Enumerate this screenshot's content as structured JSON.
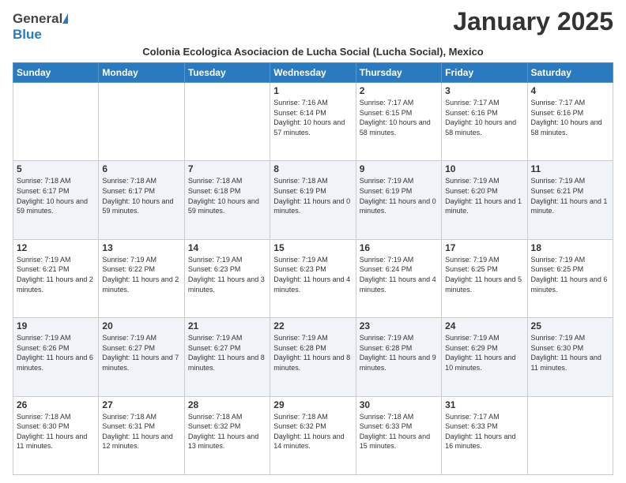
{
  "header": {
    "logo_general": "General",
    "logo_blue": "Blue",
    "main_title": "January 2025",
    "subtitle": "Colonia Ecologica Asociacion de Lucha Social (Lucha Social), Mexico"
  },
  "weekdays": [
    "Sunday",
    "Monday",
    "Tuesday",
    "Wednesday",
    "Thursday",
    "Friday",
    "Saturday"
  ],
  "weeks": [
    {
      "shaded": false,
      "days": [
        {
          "num": "",
          "info": ""
        },
        {
          "num": "",
          "info": ""
        },
        {
          "num": "",
          "info": ""
        },
        {
          "num": "1",
          "info": "Sunrise: 7:16 AM\nSunset: 6:14 PM\nDaylight: 10 hours\nand 57 minutes."
        },
        {
          "num": "2",
          "info": "Sunrise: 7:17 AM\nSunset: 6:15 PM\nDaylight: 10 hours\nand 58 minutes."
        },
        {
          "num": "3",
          "info": "Sunrise: 7:17 AM\nSunset: 6:16 PM\nDaylight: 10 hours\nand 58 minutes."
        },
        {
          "num": "4",
          "info": "Sunrise: 7:17 AM\nSunset: 6:16 PM\nDaylight: 10 hours\nand 58 minutes."
        }
      ]
    },
    {
      "shaded": true,
      "days": [
        {
          "num": "5",
          "info": "Sunrise: 7:18 AM\nSunset: 6:17 PM\nDaylight: 10 hours\nand 59 minutes."
        },
        {
          "num": "6",
          "info": "Sunrise: 7:18 AM\nSunset: 6:17 PM\nDaylight: 10 hours\nand 59 minutes."
        },
        {
          "num": "7",
          "info": "Sunrise: 7:18 AM\nSunset: 6:18 PM\nDaylight: 10 hours\nand 59 minutes."
        },
        {
          "num": "8",
          "info": "Sunrise: 7:18 AM\nSunset: 6:19 PM\nDaylight: 11 hours\nand 0 minutes."
        },
        {
          "num": "9",
          "info": "Sunrise: 7:19 AM\nSunset: 6:19 PM\nDaylight: 11 hours\nand 0 minutes."
        },
        {
          "num": "10",
          "info": "Sunrise: 7:19 AM\nSunset: 6:20 PM\nDaylight: 11 hours\nand 1 minute."
        },
        {
          "num": "11",
          "info": "Sunrise: 7:19 AM\nSunset: 6:21 PM\nDaylight: 11 hours\nand 1 minute."
        }
      ]
    },
    {
      "shaded": false,
      "days": [
        {
          "num": "12",
          "info": "Sunrise: 7:19 AM\nSunset: 6:21 PM\nDaylight: 11 hours\nand 2 minutes."
        },
        {
          "num": "13",
          "info": "Sunrise: 7:19 AM\nSunset: 6:22 PM\nDaylight: 11 hours\nand 2 minutes."
        },
        {
          "num": "14",
          "info": "Sunrise: 7:19 AM\nSunset: 6:23 PM\nDaylight: 11 hours\nand 3 minutes."
        },
        {
          "num": "15",
          "info": "Sunrise: 7:19 AM\nSunset: 6:23 PM\nDaylight: 11 hours\nand 4 minutes."
        },
        {
          "num": "16",
          "info": "Sunrise: 7:19 AM\nSunset: 6:24 PM\nDaylight: 11 hours\nand 4 minutes."
        },
        {
          "num": "17",
          "info": "Sunrise: 7:19 AM\nSunset: 6:25 PM\nDaylight: 11 hours\nand 5 minutes."
        },
        {
          "num": "18",
          "info": "Sunrise: 7:19 AM\nSunset: 6:25 PM\nDaylight: 11 hours\nand 6 minutes."
        }
      ]
    },
    {
      "shaded": true,
      "days": [
        {
          "num": "19",
          "info": "Sunrise: 7:19 AM\nSunset: 6:26 PM\nDaylight: 11 hours\nand 6 minutes."
        },
        {
          "num": "20",
          "info": "Sunrise: 7:19 AM\nSunset: 6:27 PM\nDaylight: 11 hours\nand 7 minutes."
        },
        {
          "num": "21",
          "info": "Sunrise: 7:19 AM\nSunset: 6:27 PM\nDaylight: 11 hours\nand 8 minutes."
        },
        {
          "num": "22",
          "info": "Sunrise: 7:19 AM\nSunset: 6:28 PM\nDaylight: 11 hours\nand 8 minutes."
        },
        {
          "num": "23",
          "info": "Sunrise: 7:19 AM\nSunset: 6:28 PM\nDaylight: 11 hours\nand 9 minutes."
        },
        {
          "num": "24",
          "info": "Sunrise: 7:19 AM\nSunset: 6:29 PM\nDaylight: 11 hours\nand 10 minutes."
        },
        {
          "num": "25",
          "info": "Sunrise: 7:19 AM\nSunset: 6:30 PM\nDaylight: 11 hours\nand 11 minutes."
        }
      ]
    },
    {
      "shaded": false,
      "days": [
        {
          "num": "26",
          "info": "Sunrise: 7:18 AM\nSunset: 6:30 PM\nDaylight: 11 hours\nand 11 minutes."
        },
        {
          "num": "27",
          "info": "Sunrise: 7:18 AM\nSunset: 6:31 PM\nDaylight: 11 hours\nand 12 minutes."
        },
        {
          "num": "28",
          "info": "Sunrise: 7:18 AM\nSunset: 6:32 PM\nDaylight: 11 hours\nand 13 minutes."
        },
        {
          "num": "29",
          "info": "Sunrise: 7:18 AM\nSunset: 6:32 PM\nDaylight: 11 hours\nand 14 minutes."
        },
        {
          "num": "30",
          "info": "Sunrise: 7:18 AM\nSunset: 6:33 PM\nDaylight: 11 hours\nand 15 minutes."
        },
        {
          "num": "31",
          "info": "Sunrise: 7:17 AM\nSunset: 6:33 PM\nDaylight: 11 hours\nand 16 minutes."
        },
        {
          "num": "",
          "info": ""
        }
      ]
    }
  ]
}
